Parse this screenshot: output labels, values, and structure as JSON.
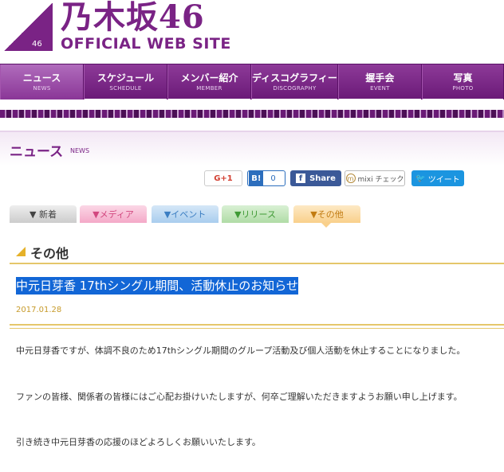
{
  "header": {
    "logo_name": "乃木坂46",
    "logo_sub": "OFFICIAL WEB SITE",
    "logo_mark_number": "46"
  },
  "nav": [
    {
      "jp": "ニュース",
      "en": "NEWS"
    },
    {
      "jp": "スケジュール",
      "en": "SCHEDULE"
    },
    {
      "jp": "メンバー紹介",
      "en": "MEMBER"
    },
    {
      "jp": "ディスコグラフィー",
      "en": "DISCOGRAPHY"
    },
    {
      "jp": "握手会",
      "en": "EVENT"
    },
    {
      "jp": "写真",
      "en": "PHOTO"
    }
  ],
  "page": {
    "title": "ニュース",
    "title_en": "NEWS"
  },
  "social": {
    "gplus": "G+1",
    "hatena_b": "B!",
    "hatena_count": "0",
    "fb_label": "Share",
    "mixi_label": "mixi チェック",
    "twitter_label": "ツイート"
  },
  "categories": {
    "new": "▼ 新着",
    "media": "▼メディア",
    "event": "▼イベント",
    "release": "▼リリース",
    "other": "▼その他"
  },
  "section": {
    "title": "その他"
  },
  "article": {
    "title": "中元日芽香 17thシングル期間、活動休止のお知らせ",
    "date": "2017.01.28",
    "paragraphs": [
      "中元日芽香ですが、体調不良のため17thシングル期間のグループ活動及び個人活動を休止することになりました。",
      "ファンの皆様、関係者の皆様にはご心配お掛けいたしますが、何卒ご理解いただきますようお願い申し上げます。",
      "引き続き中元日芽香の応援のほどよろしくお願いいたします。"
    ]
  },
  "colors": {
    "brand_purple": "#7a2385",
    "accent_gold": "#e5c76b",
    "selection_blue": "#1266d6"
  }
}
